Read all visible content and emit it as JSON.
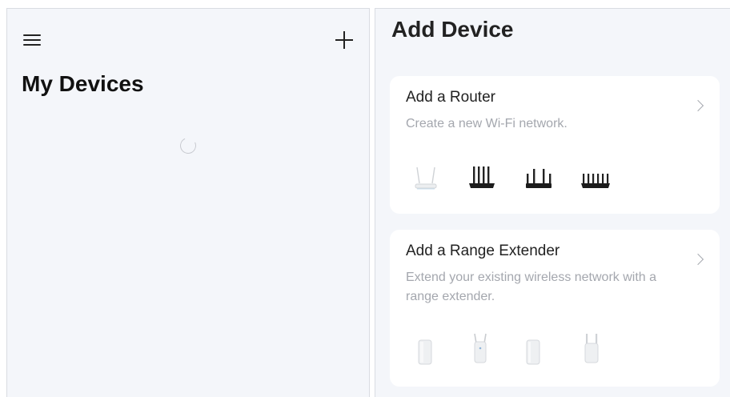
{
  "left": {
    "title": "My Devices",
    "menu_icon": "hamburger-menu-icon",
    "add_icon": "plus-icon",
    "loading_icon": "loading-spinner-icon"
  },
  "right": {
    "title": "Add Device",
    "cards": [
      {
        "title": "Add a Router",
        "subtitle": "Create a new Wi-Fi network.",
        "icon": "chevron-right-icon",
        "device_images": [
          "white-router-icon",
          "black-router-icon",
          "black-router-icon",
          "black-router-icon"
        ]
      },
      {
        "title": "Add a Range Extender",
        "subtitle": "Extend your existing wireless network with a range extender.",
        "icon": "chevron-right-icon",
        "device_images": [
          "range-extender-icon",
          "range-extender-icon",
          "range-extender-icon",
          "range-extender-icon"
        ]
      }
    ]
  },
  "colors": {
    "panel_background": "#f4f6fa",
    "card_background": "#ffffff",
    "title_text": "#222222",
    "subtitle_text": "#a4a7ae"
  }
}
